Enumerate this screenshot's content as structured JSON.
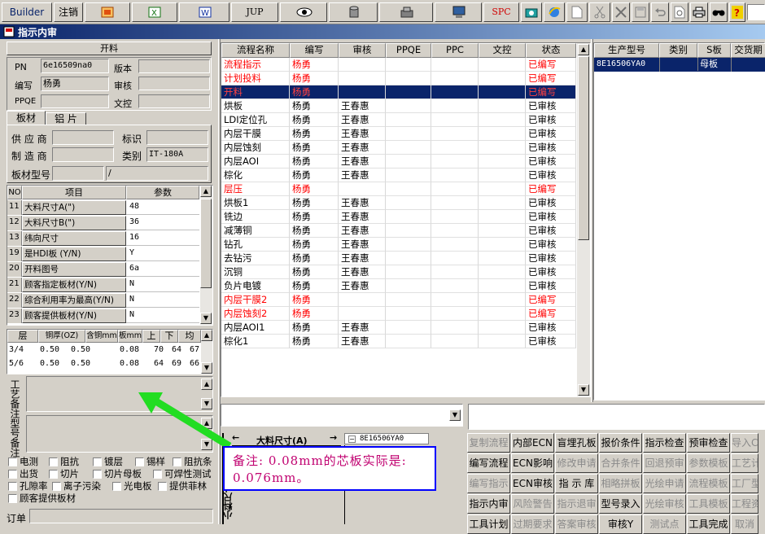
{
  "toolbar": {
    "builder": "Builder",
    "logout": "注销",
    "jup": "JUP",
    "spc": "SPC",
    "icons": [
      "report-icon",
      "excel-icon",
      "word-icon",
      "jup-icon",
      "eye-icon",
      "database-icon",
      "tools-icon",
      "computer-icon",
      "spc-icon",
      "camera-icon",
      "ie-icon",
      "new-doc-icon",
      "cut-icon",
      "close-x-icon",
      "save-icon",
      "undo-icon",
      "preview-icon",
      "print-icon",
      "find-icon",
      "help-icon"
    ]
  },
  "window": {
    "title": "指示内审"
  },
  "cutting": {
    "header": "开料",
    "pn_label": "PN",
    "pn_value": "6e16509na0",
    "version_label": "版本",
    "version_value": "",
    "author_label": "编写",
    "author_value": "杨勇",
    "review_label": "审核",
    "review_value": "",
    "ppqe_label": "PPQE",
    "ppqe_value": "",
    "control_label": "文控",
    "control_value": ""
  },
  "material_tabs": [
    "板材",
    "铝 片"
  ],
  "material": {
    "supplier_label": "供 应 商",
    "mark_label": "标识",
    "maker_label": "制 造 商",
    "category_label": "类别",
    "category_value": "IT-180A",
    "model_label": "板材型号",
    "model_value2": "/"
  },
  "param_table": {
    "headers": [
      "NO",
      "项目",
      "参数"
    ],
    "rows": [
      [
        "11",
        "大料尺寸A(\")",
        "48"
      ],
      [
        "12",
        "大料尺寸B(\")",
        "36"
      ],
      [
        "13",
        "纬向尺寸",
        "16"
      ],
      [
        "19",
        "是HDI板 (Y/N)",
        "Y"
      ],
      [
        "20",
        "开料图号",
        "6a"
      ],
      [
        "21",
        "顾客指定板材(Y/N)",
        "N"
      ],
      [
        "22",
        "综合利用率为最高(Y/N)",
        "N"
      ],
      [
        "23",
        "顾客提供板材(Y/N)",
        "N"
      ]
    ]
  },
  "layer_table": {
    "headers": [
      "层",
      "铜厚(OZ)",
      "含铜mm",
      "板mm",
      "上",
      "下",
      "均"
    ],
    "rows": [
      [
        "3/4",
        "0.50",
        "0.50",
        "0.08",
        "70",
        "64",
        "67."
      ],
      [
        "5/6",
        "0.50",
        "0.50",
        "0.08",
        "64",
        "69",
        "66."
      ]
    ]
  },
  "notes": {
    "process_label": "工艺备注",
    "type_label": "型号备注"
  },
  "checks": {
    "row1": [
      "电测",
      "阻抗",
      "镀层",
      "锡样",
      "阻抗条"
    ],
    "row2": [
      "出货",
      "切片",
      "切片母板",
      "可焊性测试"
    ],
    "row3": [
      "孔隙率",
      "离子污染",
      "光电板",
      "提供菲林"
    ],
    "row4": [
      "顾客提供板材"
    ],
    "order_label": "订单"
  },
  "flow": {
    "headers": [
      "流程名称",
      "编写",
      "审核",
      "PPQE",
      "PPC",
      "文控",
      "状态"
    ],
    "rows": [
      {
        "name": "流程指示",
        "author": "杨勇",
        "reviewer": "",
        "status": "已编写",
        "tone": "red"
      },
      {
        "name": "计划投料",
        "author": "杨勇",
        "reviewer": "",
        "status": "已编写",
        "tone": "red"
      },
      {
        "name": "开料",
        "author": "杨勇",
        "reviewer": "",
        "status": "已编写",
        "tone": "sel"
      },
      {
        "name": "烘板",
        "author": "杨勇",
        "reviewer": "王春惠",
        "status": "已审核",
        "tone": "black"
      },
      {
        "name": "LDI定位孔",
        "author": "杨勇",
        "reviewer": "王春惠",
        "status": "已审核",
        "tone": "black"
      },
      {
        "name": "内层干膜",
        "author": "杨勇",
        "reviewer": "王春惠",
        "status": "已审核",
        "tone": "black"
      },
      {
        "name": "内层蚀刻",
        "author": "杨勇",
        "reviewer": "王春惠",
        "status": "已审核",
        "tone": "black"
      },
      {
        "name": "内层AOI",
        "author": "杨勇",
        "reviewer": "王春惠",
        "status": "已审核",
        "tone": "black"
      },
      {
        "name": "棕化",
        "author": "杨勇",
        "reviewer": "王春惠",
        "status": "已审核",
        "tone": "black"
      },
      {
        "name": "层压",
        "author": "杨勇",
        "reviewer": "",
        "status": "已编写",
        "tone": "red"
      },
      {
        "name": "烘板1",
        "author": "杨勇",
        "reviewer": "王春惠",
        "status": "已审核",
        "tone": "black"
      },
      {
        "name": "铣边",
        "author": "杨勇",
        "reviewer": "王春惠",
        "status": "已审核",
        "tone": "black"
      },
      {
        "name": "减薄铜",
        "author": "杨勇",
        "reviewer": "王春惠",
        "status": "已审核",
        "tone": "black"
      },
      {
        "name": "钻孔",
        "author": "杨勇",
        "reviewer": "王春惠",
        "status": "已审核",
        "tone": "black"
      },
      {
        "name": "去钻污",
        "author": "杨勇",
        "reviewer": "王春惠",
        "status": "已审核",
        "tone": "black"
      },
      {
        "name": "沉铜",
        "author": "杨勇",
        "reviewer": "王春惠",
        "status": "已审核",
        "tone": "black"
      },
      {
        "name": "负片电镀",
        "author": "杨勇",
        "reviewer": "王春惠",
        "status": "已审核",
        "tone": "black"
      },
      {
        "name": "内层干膜2",
        "author": "杨勇",
        "reviewer": "",
        "status": "已编写",
        "tone": "red"
      },
      {
        "name": "内层蚀刻2",
        "author": "杨勇",
        "reviewer": "",
        "status": "已编写",
        "tone": "red"
      },
      {
        "name": "内层AOI1",
        "author": "杨勇",
        "reviewer": "王春惠",
        "status": "已审核",
        "tone": "black"
      },
      {
        "name": "棕化1",
        "author": "杨勇",
        "reviewer": "王春惠",
        "status": "已审核",
        "tone": "black"
      }
    ]
  },
  "prod": {
    "headers": [
      "生产型号",
      "类别",
      "S板",
      "交货期"
    ],
    "row": [
      "8E16506YA0",
      "",
      "母板",
      ""
    ]
  },
  "diagram": {
    "label": "大料尺寸(A)",
    "node": "8E16506YA0",
    "side": "小料尺寸"
  },
  "annotation": {
    "text": "备注: 0.08mm的芯板实际是: 0.076mm。"
  },
  "buttons": [
    [
      {
        "t": "复制流程",
        "d": true
      },
      {
        "t": "内部ECN",
        "d": false
      },
      {
        "t": "盲埋孔板",
        "d": false
      },
      {
        "t": "报价条件",
        "d": false
      },
      {
        "t": "指示检查",
        "d": false
      },
      {
        "t": "预审检查",
        "d": false
      },
      {
        "t": "导入C",
        "d": true
      }
    ],
    [
      {
        "t": "编写流程",
        "d": false
      },
      {
        "t": "ECN影响",
        "d": false
      },
      {
        "t": "修改申请",
        "d": true
      },
      {
        "t": "合并条件",
        "d": true
      },
      {
        "t": "回退预审",
        "d": true
      },
      {
        "t": "参数模板",
        "d": true
      },
      {
        "t": "工艺计",
        "d": true
      }
    ],
    [
      {
        "t": "编写指示",
        "d": true
      },
      {
        "t": "ECN审核",
        "d": false
      },
      {
        "t": "指 示 库",
        "d": false
      },
      {
        "t": "相略拼板",
        "d": true
      },
      {
        "t": "光绘申请",
        "d": true
      },
      {
        "t": "流程模板",
        "d": true
      },
      {
        "t": "工厂型",
        "d": true
      }
    ],
    [
      {
        "t": "指示内审",
        "d": false
      },
      {
        "t": "风险警告",
        "d": true
      },
      {
        "t": "指示退审",
        "d": true
      },
      {
        "t": "型号录入",
        "d": false
      },
      {
        "t": "光绘审核",
        "d": true
      },
      {
        "t": "工具模板",
        "d": true
      },
      {
        "t": "工程资",
        "d": true
      }
    ],
    [
      {
        "t": "工具计划",
        "d": false
      },
      {
        "t": "过期要求",
        "d": true
      },
      {
        "t": "答案审核",
        "d": true
      },
      {
        "t": "审核Y",
        "d": false
      },
      {
        "t": "测试点",
        "d": true
      },
      {
        "t": "工具完成",
        "d": false
      },
      {
        "t": "取消",
        "d": true
      }
    ]
  ],
  "colors": {
    "title_bg": "#0a246a",
    "selected_bg": "#0a246a",
    "red_text": "#ff0000",
    "annotation_border": "#0000ff",
    "arrow": "#22dd22"
  }
}
